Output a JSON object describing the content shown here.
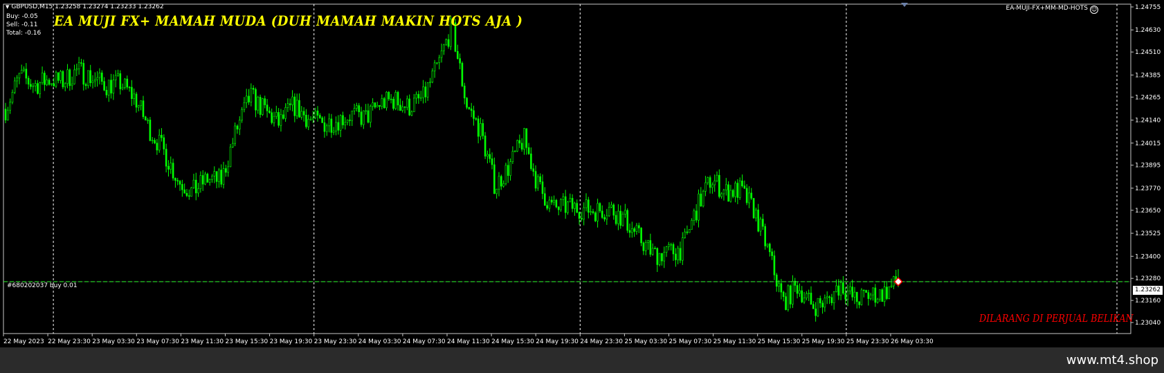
{
  "header": {
    "symbol_line": "GBPUSD,M15  1.23258 1.23274 1.23233 1.23262",
    "buy": "Buy: -0.05",
    "sell": "Sell: -0.11",
    "total": "Total: -0.16"
  },
  "ea": {
    "title": "EA MUJI FX+ MAMAH MUDA  (DUH MAMAH MAKIN HOTS AJA )",
    "name": "EA-MUJI-FX+MM-MD-HOTS",
    "warning": "DILARANG DI PERJUAL BELIKAN"
  },
  "order_line": {
    "label": "#680202037 buy 0.01",
    "price": 1.23262
  },
  "current_price": "1.23262",
  "watermark": "www.mt4.shop",
  "colors": {
    "background": "#000000",
    "candles": "#00ff00",
    "grid": "#ffffff",
    "order_line": "#00ff00",
    "title": "#ffff00",
    "warning": "#ff0000"
  },
  "chart_data": {
    "type": "candlestick",
    "symbol": "GBPUSD",
    "timeframe": "M15",
    "ylim": [
      1.2298,
      1.2477
    ],
    "y_ticks": [
      "1.24755",
      "1.24630",
      "1.24510",
      "1.24385",
      "1.24265",
      "1.24140",
      "1.24015",
      "1.23895",
      "1.23770",
      "1.23650",
      "1.23525",
      "1.23400",
      "1.23280",
      "1.23160",
      "1.23040"
    ],
    "x_ticks": [
      "22 May 2023",
      "22 May 23:30",
      "23 May 03:30",
      "23 May 07:30",
      "23 May 11:30",
      "23 May 15:30",
      "23 May 19:30",
      "23 May 23:30",
      "24 May 03:30",
      "24 May 07:30",
      "24 May 11:30",
      "24 May 15:30",
      "24 May 19:30",
      "24 May 23:30",
      "25 May 03:30",
      "25 May 07:30",
      "25 May 11:30",
      "25 May 15:30",
      "25 May 19:30",
      "25 May 23:30",
      "26 May 03:30"
    ],
    "day_separators": [
      "22 May 23:30",
      "23 May 23:30",
      "24 May 23:30",
      "25 May 23:30"
    ],
    "price_path": [
      1.242,
      1.2438,
      1.2433,
      1.2436,
      1.2435,
      1.2441,
      1.2437,
      1.2433,
      1.2434,
      1.2426,
      1.2409,
      1.2397,
      1.2381,
      1.2375,
      1.2382,
      1.2381,
      1.2408,
      1.2427,
      1.2419,
      1.2412,
      1.2422,
      1.2415,
      1.2412,
      1.2414,
      1.2417,
      1.2415,
      1.2423,
      1.2425,
      1.2421,
      1.2426,
      1.2443,
      1.2465,
      1.2423,
      1.2408,
      1.2378,
      1.2389,
      1.2404,
      1.2378,
      1.2366,
      1.2367,
      1.2366,
      1.2365,
      1.2366,
      1.236,
      1.235,
      1.2341,
      1.2342,
      1.2344,
      1.2366,
      1.2382,
      1.2375,
      1.2376,
      1.2365,
      1.2342,
      1.2315,
      1.2324,
      1.2313,
      1.2315,
      1.2325,
      1.2316,
      1.2319,
      1.232,
      1.2326
    ]
  }
}
